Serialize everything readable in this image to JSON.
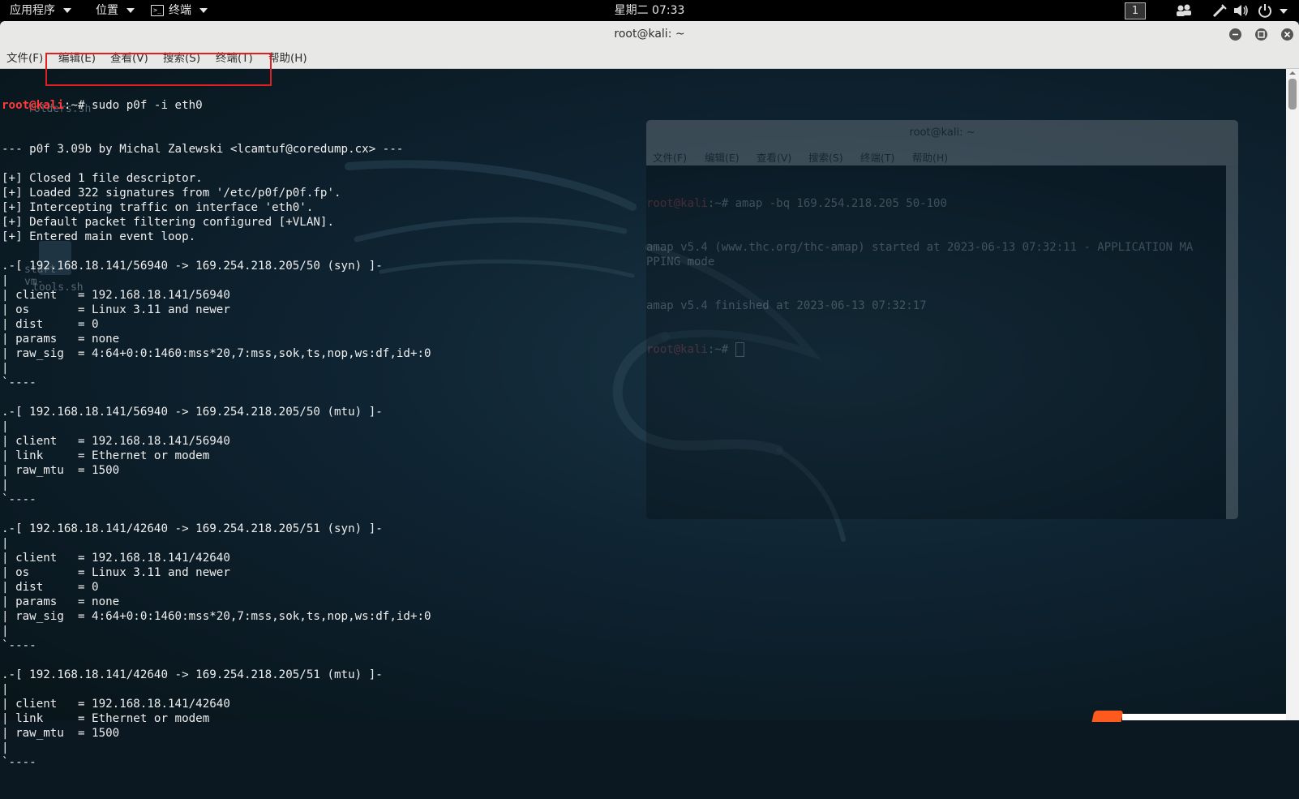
{
  "topbar": {
    "apps_label": "应用程序",
    "places_label": "位置",
    "terminal_label": "终端",
    "clock": "星期二 07:33",
    "workspace": "1"
  },
  "window": {
    "title": "root@kali: ~",
    "menus": [
      "文件(F)",
      "编辑(E)",
      "查看(V)",
      "搜索(S)",
      "终端(T)",
      "帮助(H)"
    ]
  },
  "terminal": {
    "prompt_user": "root@kali",
    "prompt_rest": ":~# ",
    "command": "sudo p0f -i eth0",
    "lines": [
      "--- p0f 3.09b by Michal Zalewski <lcamtuf@coredump.cx> ---",
      "",
      "[+] Closed 1 file descriptor.",
      "[+] Loaded 322 signatures from '/etc/p0f/p0f.fp'.",
      "[+] Intercepting traffic on interface 'eth0'.",
      "[+] Default packet filtering configured [+VLAN].",
      "[+] Entered main event loop.",
      "",
      ".-[ 192.168.18.141/56940 -> 169.254.218.205/50 (syn) ]-",
      "|",
      "| client   = 192.168.18.141/56940",
      "| os       = Linux 3.11 and newer",
      "| dist     = 0",
      "| params   = none",
      "| raw_sig  = 4:64+0:0:1460:mss*20,7:mss,sok,ts,nop,ws:df,id+:0",
      "|",
      "`----",
      "",
      ".-[ 192.168.18.141/56940 -> 169.254.218.205/50 (mtu) ]-",
      "|",
      "| client   = 192.168.18.141/56940",
      "| link     = Ethernet or modem",
      "| raw_mtu  = 1500",
      "|",
      "`----",
      "",
      ".-[ 192.168.18.141/42640 -> 169.254.218.205/51 (syn) ]-",
      "|",
      "| client   = 192.168.18.141/42640",
      "| os       = Linux 3.11 and newer",
      "| dist     = 0",
      "| params   = none",
      "| raw_sig  = 4:64+0:0:1460:mss*20,7:mss,sok,ts,nop,ws:df,id+:0",
      "|",
      "`----",
      "",
      ".-[ 192.168.18.141/42640 -> 169.254.218.205/51 (mtu) ]-",
      "|",
      "| client   = 192.168.18.141/42640",
      "| link     = Ethernet or modem",
      "| raw_mtu  = 1500",
      "|",
      "`----"
    ]
  },
  "desktop": {
    "icons": [
      "folders.sh",
      "start-vm-",
      "tools.sh"
    ]
  },
  "ghost_window": {
    "title": "root@kali: ~",
    "menus": [
      "文件(F)",
      "编辑(E)",
      "查看(V)",
      "搜索(S)",
      "终端(T)",
      "帮助(H)"
    ],
    "prompt_user": "root@kali",
    "prompt_rest": ":~# ",
    "command": "amap -bq 169.254.218.205 50-100",
    "lines": [
      "amap v5.4 (www.thc.org/thc-amap) started at 2023-06-13 07:32:11 - APPLICATION MA",
      "PPING mode",
      "",
      "",
      "amap v5.4 finished at 2023-06-13 07:32:17"
    ]
  },
  "colors": {
    "prompt_red": "#ff3a3a",
    "highlight_box": "#e02020",
    "topbar_bg": "#000000",
    "window_chrome": "#e8e8e7"
  }
}
